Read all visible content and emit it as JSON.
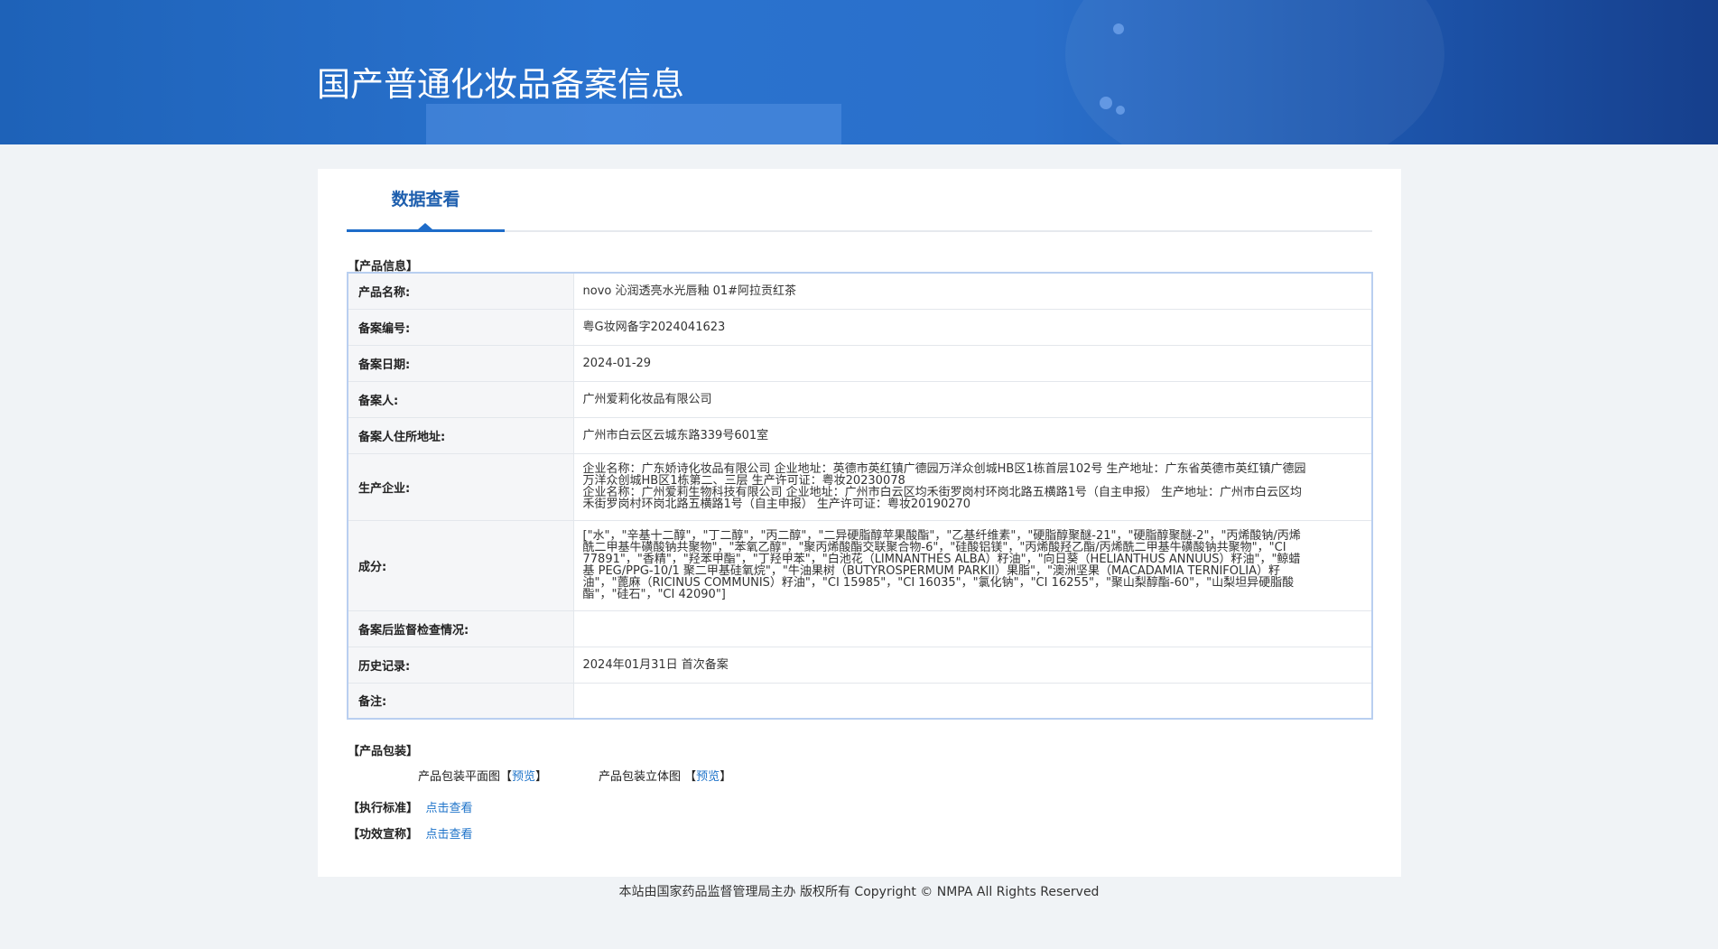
{
  "header": {
    "title": "国产普通化妆品备案信息"
  },
  "tabs": [
    {
      "label": "数据查看"
    }
  ],
  "sections": {
    "product_info": "【产品信息】",
    "packaging": "【产品包装】",
    "standard": "【执行标准】",
    "efficacy": "【功效宣称】"
  },
  "product": [
    {
      "key": "产品名称:",
      "value": "novo 沁润透亮水光唇釉 01#阿拉贡红茶"
    },
    {
      "key": "备案编号:",
      "value": "粤G妆网备字2024041623"
    },
    {
      "key": "备案日期:",
      "value": "2024-01-29"
    },
    {
      "key": "备案人:",
      "value": "广州爱莉化妆品有限公司"
    },
    {
      "key": "备案人住所地址:",
      "value": "广州市白云区云城东路339号601室"
    },
    {
      "key": "生产企业:",
      "lines": [
        "企业名称：广东娇诗化妆品有限公司 企业地址：英德市英红镇广德园万洋众创城HB区1栋首层102号 生产地址：广东省英德市英红镇广德园",
        "万洋众创城HB区1栋第二、三层 生产许可证：粤妆20230078",
        "企业名称：广州爱莉生物科技有限公司 企业地址：广州市白云区均禾街罗岗村环岗北路五横路1号（自主申报） 生产地址：广州市白云区均",
        "禾街罗岗村环岗北路五横路1号（自主申报） 生产许可证：粤妆20190270"
      ]
    },
    {
      "key": "成分:",
      "lines": [
        "[\"水\"，\"辛基十二醇\"，\"丁二醇\"，\"丙二醇\"，\"二异硬脂醇苹果酸酯\"，\"乙基纤维素\"，\"硬脂醇聚醚-21\"，\"硬脂醇聚醚-2\"，\"丙烯酸钠/丙烯",
        "酰二甲基牛磺酸钠共聚物\"，\"苯氧乙醇\"，\"聚丙烯酸酯交联聚合物-6\"，\"硅酸铝镁\"，\"丙烯酸羟乙酯/丙烯酰二甲基牛磺酸钠共聚物\"，\"CI",
        "77891\"，\"香精\"，\"羟苯甲酯\"，\"丁羟甲苯\"，\"白池花（LIMNANTHES ALBA）籽油\"，\"向日葵（HELIANTHUS ANNUUS）籽油\"，\"鲸蜡",
        "基 PEG/PPG-10/1 聚二甲基硅氧烷\"，\"牛油果树（BUTYROSPERMUM PARKII）果脂\"，\"澳洲坚果（MACADAMIA TERNIFOLIA）籽",
        "油\"，\"蓖麻（RICINUS COMMUNIS）籽油\"，\"CI 15985\"，\"CI 16035\"，\"氯化钠\"，\"CI 16255\"，\"聚山梨醇酯-60\"，\"山梨坦异硬脂酸",
        "酯\"，\"硅石\"，\"CI 42090\"]"
      ]
    },
    {
      "key": "备案后监督检查情况:",
      "value": ""
    },
    {
      "key": "历史记录:",
      "value": "2024年01月31日 首次备案"
    },
    {
      "key": "备注:",
      "value": ""
    }
  ],
  "packaging": {
    "flat_label": "产品包装平面图",
    "solid_label": "产品包装立体图",
    "preview": "预览",
    "open_bracket": "【",
    "close_bracket": "】"
  },
  "links": {
    "view": "点击查看"
  },
  "footer": "本站由国家药品监督管理局主办 版权所有 Copyright © NMPA All Rights Reserved",
  "colors": {
    "banner": "#2a6fca",
    "accent": "#1e6cc9",
    "link": "#1e73c9"
  }
}
